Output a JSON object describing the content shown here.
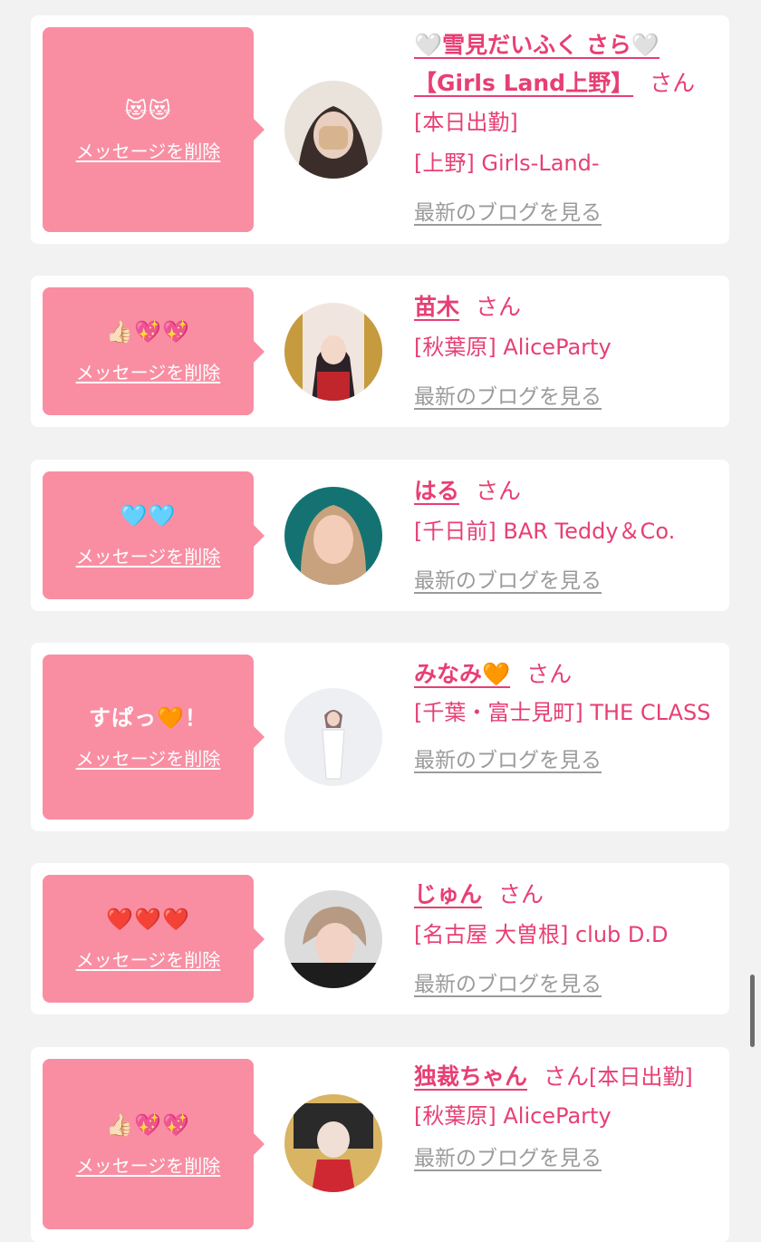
{
  "messages": [
    {
      "message": "😻😻",
      "delete_label": "メッセージを削除",
      "name": "🤍雪見だいふく さら🤍【Girls Land上野】",
      "honorific": "さん",
      "details": [
        "[本日出勤]",
        "[上野] Girls-Land-"
      ],
      "blog_label": "最新のブログを見る",
      "avatar_colors": [
        "#e9e3dc",
        "#b9a89a",
        "#3b2e2a"
      ]
    },
    {
      "message": "👍🏻💖💖",
      "delete_label": "メッセージを削除",
      "name": "苗木",
      "honorific": "さん",
      "details": [
        "[秋葉原] AliceParty"
      ],
      "blog_label": "最新のブログを見る",
      "avatar_colors": [
        "#f1e6df",
        "#c0262c",
        "#2b2227"
      ]
    },
    {
      "message": "🩵🩵",
      "delete_label": "メッセージを削除",
      "name": "はる",
      "honorific": "さん",
      "details": [
        "[千日前] BAR Teddy＆Co."
      ],
      "blog_label": "最新のブログを見る",
      "avatar_colors": [
        "#147372",
        "#c8a27e",
        "#f4cdb8"
      ]
    },
    {
      "message": "すぱっ🧡！",
      "delete_label": "メッセージを削除",
      "name": "みなみ🧡",
      "honorific": "さん",
      "details": [
        "[千葉・富士見町] THE CLASS"
      ],
      "blog_label": "最新のブログを見る",
      "avatar_colors": [
        "#eeeff3",
        "#ffffff",
        "#8d6e6e"
      ]
    },
    {
      "message": "❤️❤️❤️",
      "delete_label": "メッセージを削除",
      "name": "じゅん",
      "honorific": "さん",
      "details": [
        "[名古屋 大曽根] club D.D"
      ],
      "blog_label": "最新のブログを見る",
      "avatar_colors": [
        "#dcdcdc",
        "#1d1d1d",
        "#f2d2c4"
      ]
    },
    {
      "message": "👍🏻💖💖",
      "delete_label": "メッセージを削除",
      "name": "独裁ちゃん",
      "honorific": "さん",
      "details": [
        "[本日出勤]",
        "[秋葉原] AliceParty"
      ],
      "blog_label": "最新のブログを見る",
      "avatar_colors": [
        "#d8b463",
        "#d02833",
        "#f0dfd5"
      ]
    }
  ]
}
